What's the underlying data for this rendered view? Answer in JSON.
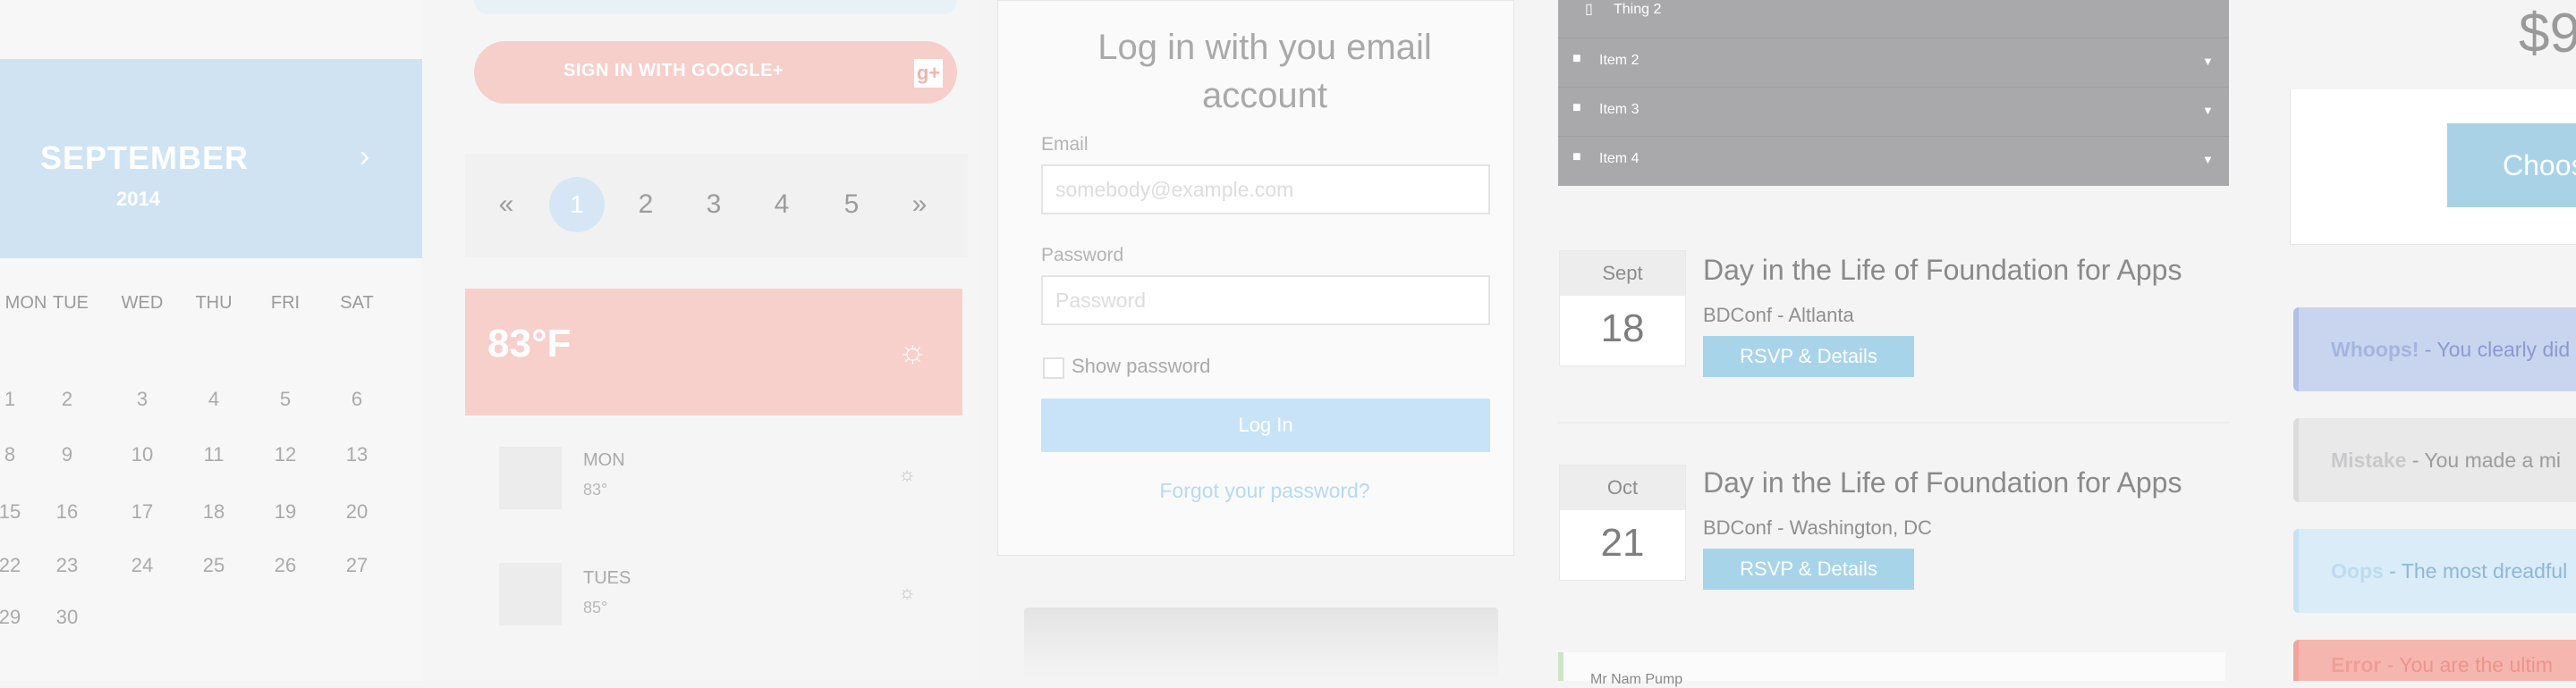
{
  "calendar": {
    "month": "SEPTEMBER",
    "year": "2014",
    "next_symbol": "›",
    "weekdays": [
      "MON",
      "TUE",
      "WED",
      "THU",
      "FRI",
      "SAT"
    ],
    "rows": [
      [
        "1",
        "2",
        "3",
        "4",
        "5",
        "6"
      ],
      [
        "8",
        "9",
        "10",
        "11",
        "12",
        "13"
      ],
      [
        "15",
        "16",
        "17",
        "18",
        "19",
        "20"
      ],
      [
        "22",
        "23",
        "24",
        "25",
        "26",
        "27"
      ],
      [
        "29",
        "30",
        "",
        "",
        "",
        ""
      ]
    ]
  },
  "social": {
    "google_label": "SIGN IN WITH GOOGLE+",
    "google_icon": "g+"
  },
  "pagination": {
    "prev": "«",
    "pages": [
      "1",
      "2",
      "3",
      "4",
      "5"
    ],
    "next": "»",
    "active": "1"
  },
  "weather": {
    "current_temp": "83°F",
    "icon": "sun-icon",
    "days": [
      {
        "day": "MON",
        "temp": "83°"
      },
      {
        "day": "TUES",
        "temp": "85°"
      }
    ]
  },
  "login": {
    "title_line1": "Log in with you email",
    "title_line2": "account",
    "email_label": "Email",
    "email_placeholder": "somebody@example.com",
    "password_label": "Password",
    "password_placeholder": "Password",
    "show_password": "Show password",
    "submit": "Log In",
    "forgot": "Forgot your password?"
  },
  "accordion": {
    "items": [
      {
        "label": "Thing 2",
        "icon": "file-icon"
      },
      {
        "label": "Item 2",
        "icon": "folder-icon"
      },
      {
        "label": "Item 3",
        "icon": "folder-icon"
      },
      {
        "label": "Item 4",
        "icon": "folder-icon"
      }
    ]
  },
  "events": [
    {
      "month": "Sept",
      "day": "18",
      "title": "Day in the Life of Foundation for Apps",
      "subtitle": "BDConf - Altlanta",
      "button": "RSVP & Details"
    },
    {
      "month": "Oct",
      "day": "21",
      "title": "Day in the Life of Foundation for Apps",
      "subtitle": "BDConf - Washington, DC",
      "button": "RSVP & Details"
    }
  ],
  "notice": {
    "text": "Mr Nam Pump"
  },
  "pricing": {
    "price": "$9",
    "button": "Choos"
  },
  "alerts": [
    {
      "bold": "Whoops!",
      "text": " - You clearly did",
      "bg": "#c9d4ee",
      "border": "#b0c0e6",
      "bold_color": "#a3b5df",
      "text_color": "#8a9ad0"
    },
    {
      "bold": "Mistake",
      "text": " - You made a mi",
      "bg": "#e9e9ea",
      "border": "#dcdcdd",
      "bold_color": "#c9c9cb",
      "text_color": "#9c9c9c"
    },
    {
      "bold": "Oops",
      "text": " - The most dreadful",
      "bg": "#d9ecf8",
      "border": "#c8e2f4",
      "bold_color": "#bcdcf0",
      "text_color": "#8fb8d6"
    },
    {
      "bold": "Error",
      "text": " - You are the ultim",
      "bg": "#f6b6b0",
      "border": "#f0a49c",
      "bold_color": "#f09e96",
      "text_color": "#ec948b"
    }
  ]
}
